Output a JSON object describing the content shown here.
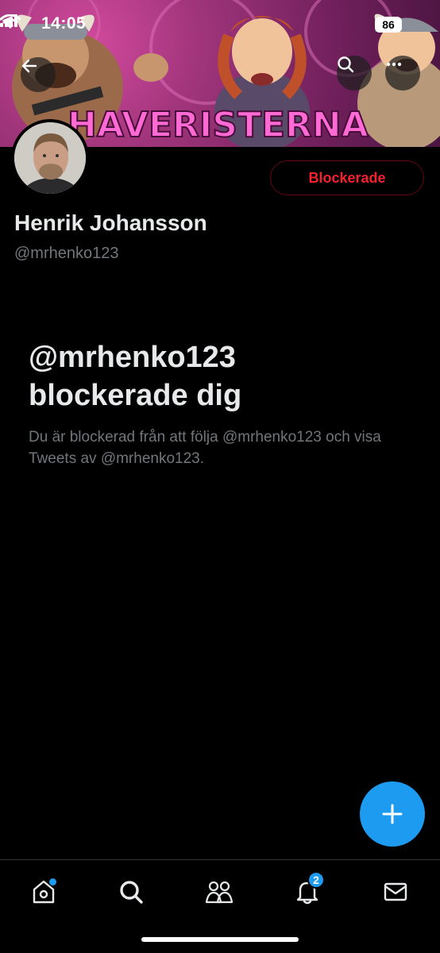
{
  "status_bar": {
    "time": "14:05",
    "battery": "86"
  },
  "banner": {
    "text": "HAVERISTERNA"
  },
  "profile": {
    "display_name": "Henrik Johansson",
    "handle": "@mrhenko123",
    "blocked_button_label": "Blockerade"
  },
  "blocked_notice": {
    "title": "@mrhenko123 blockerade dig",
    "description": "Du är blockerad från att följa @mrhenko123 och visa Tweets av @mrhenko123."
  },
  "tabbar": {
    "items": [
      {
        "name": "home",
        "icon": "home-icon",
        "has_dot": true
      },
      {
        "name": "search",
        "icon": "search-icon"
      },
      {
        "name": "communities",
        "icon": "people-icon"
      },
      {
        "name": "notifications",
        "icon": "bell-icon",
        "badge": "2"
      },
      {
        "name": "messages",
        "icon": "mail-icon"
      }
    ]
  },
  "colors": {
    "accent": "#1d9bf0",
    "blocked_red": "#f4212e",
    "secondary_text": "#71767b"
  }
}
